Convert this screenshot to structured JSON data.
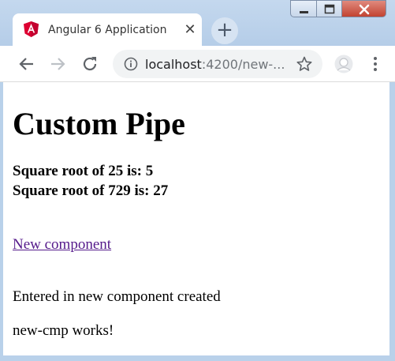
{
  "browser": {
    "tab": {
      "title": "Angular 6 Application",
      "favicon": "angular-icon",
      "close_glyph": "✕"
    },
    "new_tab_glyph": "+",
    "window_controls": [
      "minimize-icon",
      "maximize-icon",
      "close-icon"
    ],
    "address": {
      "host": "localhost",
      "path": ":4200/new-..."
    },
    "toolbar_icons": [
      "back-arrow-icon",
      "forward-arrow-icon",
      "reload-icon",
      "info-icon",
      "star-icon",
      "profile-icon",
      "menu-icon"
    ]
  },
  "page": {
    "heading": "Custom Pipe",
    "results": [
      "Square root of 25 is: 5",
      "Square root of 729 is: 27"
    ],
    "link_text": "New component",
    "paragraphs": [
      "Entered in new component created",
      "new-cmp works!"
    ]
  },
  "colors": {
    "frame": "#b9d1ea",
    "link": "#551a8b",
    "angular_red": "#dd0031"
  }
}
